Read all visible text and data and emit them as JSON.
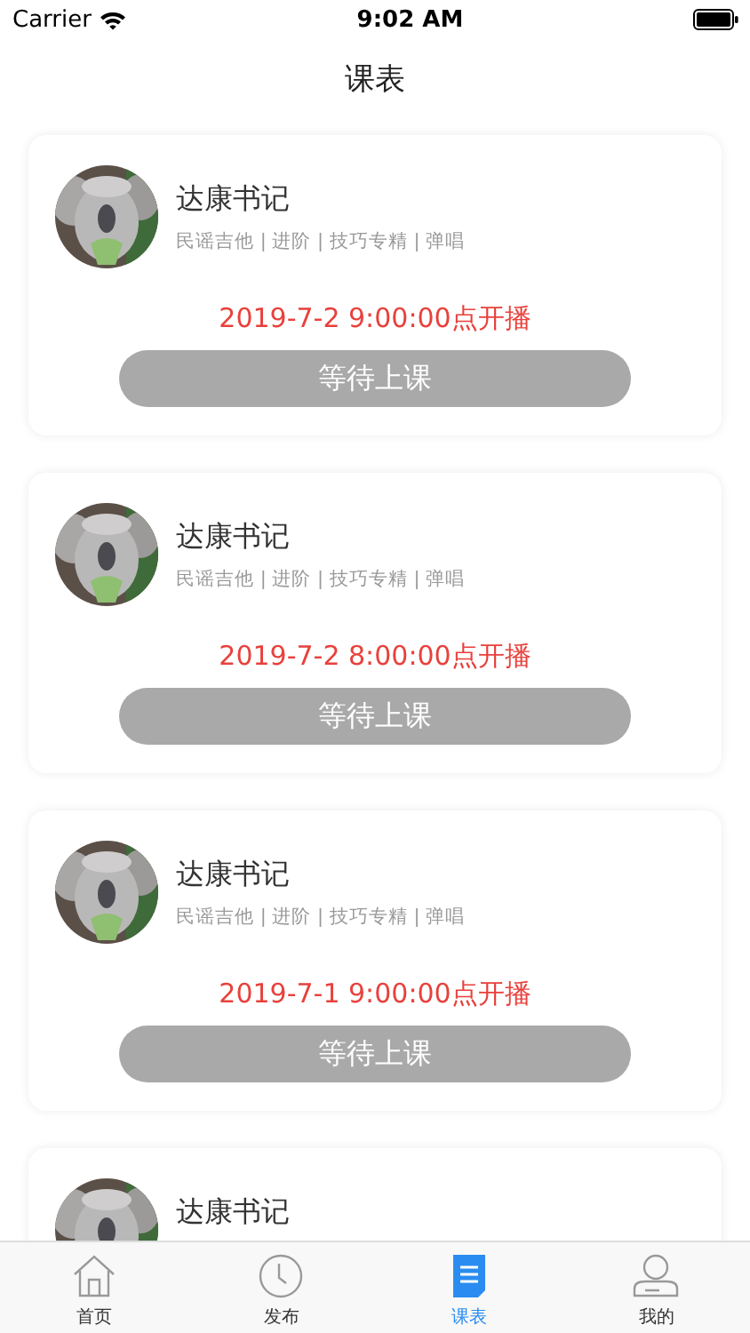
{
  "status_bar": {
    "carrier": "Carrier",
    "time": "9:02 AM"
  },
  "title": "课表",
  "courses": [
    {
      "name": "达康书记",
      "tags": "民谣吉他 | 进阶 | 技巧专精 | 弹唱",
      "start": "2019-7-2 9:00:00点开播",
      "button": {
        "label": "等待上课",
        "disabled": true
      }
    },
    {
      "name": "达康书记",
      "tags": "民谣吉他 | 进阶 | 技巧专精 | 弹唱",
      "start": "2019-7-2 8:00:00点开播",
      "button": {
        "label": "等待上课",
        "disabled": true
      }
    },
    {
      "name": "达康书记",
      "tags": "民谣吉他 | 进阶 | 技巧专精 | 弹唱",
      "start": "2019-7-1 9:00:00点开播",
      "button": {
        "label": "等待上课",
        "disabled": true
      }
    },
    {
      "name": "达康书记"
    }
  ],
  "tabs": [
    {
      "label": "首页",
      "kind": "home",
      "selected": false
    },
    {
      "label": "发布",
      "kind": "clock",
      "selected": false
    },
    {
      "label": "课表",
      "kind": "list",
      "selected": true
    },
    {
      "label": "我的",
      "kind": "person",
      "selected": false
    }
  ]
}
